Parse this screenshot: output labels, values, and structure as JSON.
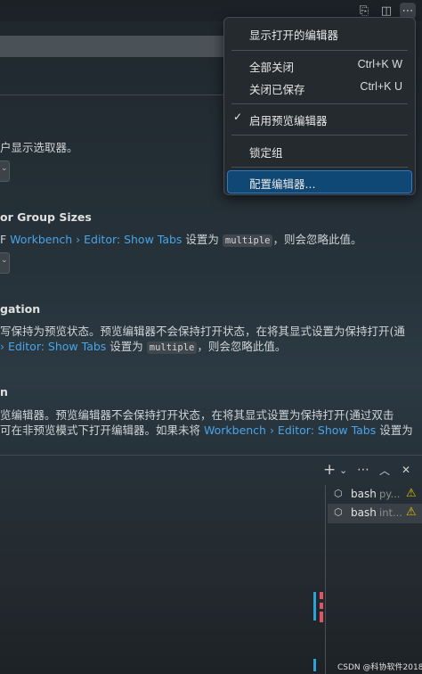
{
  "menu": {
    "items": [
      {
        "label": "显示打开的编辑器",
        "shortcut": ""
      },
      {
        "label": "全部关闭",
        "shortcut": "Ctrl+K W"
      },
      {
        "label": "关闭已保存",
        "shortcut": "Ctrl+K U"
      },
      {
        "label": "启用预览编辑器",
        "shortcut": "",
        "checked": true
      },
      {
        "label": "锁定组",
        "shortcut": ""
      },
      {
        "label": "配置编辑器...",
        "shortcut": "",
        "highlighted": true
      }
    ]
  },
  "settings": {
    "item1": {
      "desc": "户显示选取器。",
      "dropdown_glyph": "⌄"
    },
    "item2": {
      "title": "or Group Sizes",
      "desc_prefix": "F ",
      "link": "Workbench › Editor: Show Tabs",
      "desc_mid": " 设置为 ",
      "code": "multiple",
      "desc_suffix": "，则会忽略此值。",
      "dropdown_glyph": "⌄"
    },
    "item3": {
      "title": "gation",
      "desc_line1": "写保持为预览状态。预览编辑器不会保持打开状态，在将其显式设置为保持打开(通",
      "link": "› Editor: Show Tabs",
      "desc_mid": " 设置为 ",
      "code": "multiple",
      "desc_suffix": "，则会忽略此值。"
    },
    "item4": {
      "title": "n",
      "desc_line1": "览编辑器。预览编辑器不会保持打开状态，在将其显式设置为保持打开(通过双击",
      "desc_line2_prefix": "可在非预览模式下打开编辑器。如果未将 ",
      "link": "Workbench › Editor: Show Tabs",
      "desc_line2_suffix": " 设置为"
    }
  },
  "toolbar": {
    "icons": [
      "open-changes-icon",
      "split-editor-icon",
      "more-actions-icon"
    ],
    "glyphs": [
      "⎘",
      "◫",
      "⋯"
    ]
  },
  "panel": {
    "icons": [
      {
        "name": "new-terminal-icon",
        "glyph": "+"
      },
      {
        "name": "terminal-dropdown-icon",
        "glyph": "⌄"
      },
      {
        "name": "panel-more-icon",
        "glyph": "⋯"
      },
      {
        "name": "maximize-panel-icon",
        "glyph": "︿"
      },
      {
        "name": "close-panel-icon",
        "glyph": "✕"
      }
    ],
    "terminals": [
      {
        "name": "bash",
        "sub": "py...",
        "warn": "⚠"
      },
      {
        "name": "bash",
        "sub": "int...",
        "warn": "⚠"
      }
    ]
  },
  "colors": {
    "accent": "#4aa4e8",
    "highlight": "#0f4775",
    "warning": "#e2c000"
  },
  "watermark": "CSDN @科协软件2018"
}
